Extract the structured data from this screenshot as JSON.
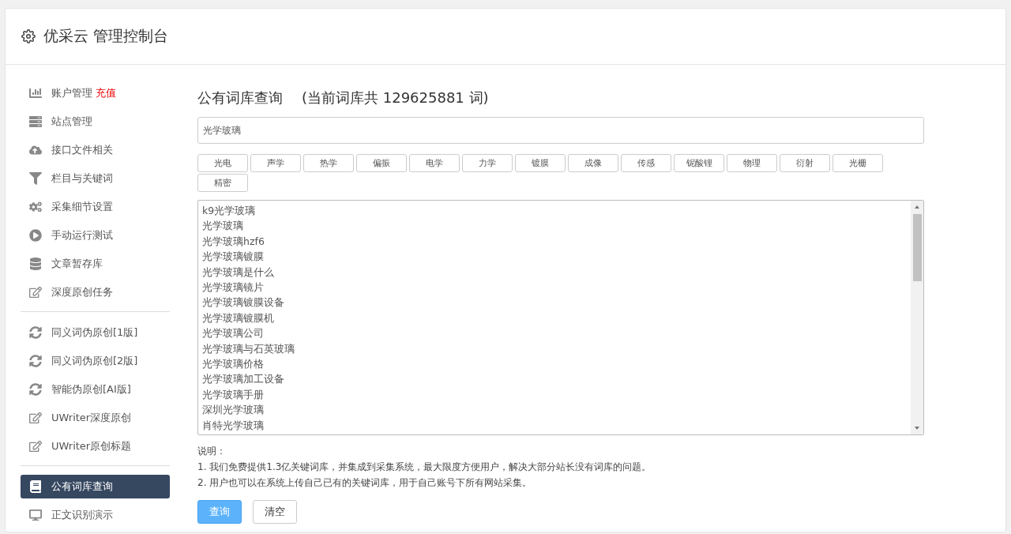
{
  "header": {
    "title": "优采云 管理控制台"
  },
  "sidebar": {
    "groups": [
      {
        "items": [
          {
            "label": "账户管理",
            "badge": "充值",
            "kind": "chart",
            "selected": false
          },
          {
            "label": "站点管理",
            "kind": "server",
            "selected": false
          },
          {
            "label": "接口文件相关",
            "kind": "cloud",
            "selected": false
          },
          {
            "label": "栏目与关键词",
            "kind": "filter",
            "selected": false
          },
          {
            "label": "采集细节设置",
            "kind": "gears",
            "selected": false
          },
          {
            "label": "手动运行测试",
            "kind": "play",
            "selected": false
          },
          {
            "label": "文章暂存库",
            "kind": "database",
            "selected": false
          },
          {
            "label": "深度原创任务",
            "kind": "edit",
            "selected": false
          }
        ]
      },
      {
        "items": [
          {
            "label": "同义词伪原创[1版]",
            "kind": "refresh",
            "selected": false
          },
          {
            "label": "同义词伪原创[2版]",
            "kind": "refresh",
            "selected": false
          },
          {
            "label": "智能伪原创[AI版]",
            "kind": "refresh",
            "selected": false
          },
          {
            "label": "UWriter深度原创",
            "kind": "edit",
            "selected": false
          },
          {
            "label": "UWriter原创标题",
            "kind": "edit",
            "selected": false
          }
        ]
      },
      {
        "items": [
          {
            "label": "公有词库查询",
            "kind": "book",
            "selected": true
          },
          {
            "label": "正文识别演示",
            "kind": "monitor",
            "selected": false
          }
        ]
      }
    ]
  },
  "main": {
    "title": "公有词库查询",
    "subtitle": "(当前词库共 129625881 词)",
    "search": {
      "value": "光学玻璃"
    },
    "tags": [
      "光电",
      "声学",
      "热学",
      "偏振",
      "电学",
      "力学",
      "镀膜",
      "成像",
      "传感",
      "铌酸锂",
      "物理",
      "衍射",
      "光栅",
      "精密"
    ],
    "results": [
      "k9光学玻璃",
      "光学玻璃",
      "光学玻璃hzf6",
      "光学玻璃镀膜",
      "光学玻璃是什么",
      "光学玻璃镜片",
      "光学玻璃镀膜设备",
      "光学玻璃镀膜机",
      "光学玻璃公司",
      "光学玻璃与石英玻璃",
      "光学玻璃价格",
      "光学玻璃加工设备",
      "光学玻璃手册",
      "深圳光学玻璃",
      "肖特光学玻璃"
    ],
    "notes_title": "说明：",
    "notes": [
      "1. 我们免费提供1.3亿关键词库，并集成到采集系统，最大限度方便用户，解决大部分站长没有词库的问题。",
      "2. 用户也可以在系统上传自己已有的关键词库，用于自己账号下所有网站采集。"
    ],
    "buttons": [
      {
        "label": "查询",
        "kind": "primary"
      },
      {
        "label": "清空",
        "kind": "default"
      }
    ]
  }
}
